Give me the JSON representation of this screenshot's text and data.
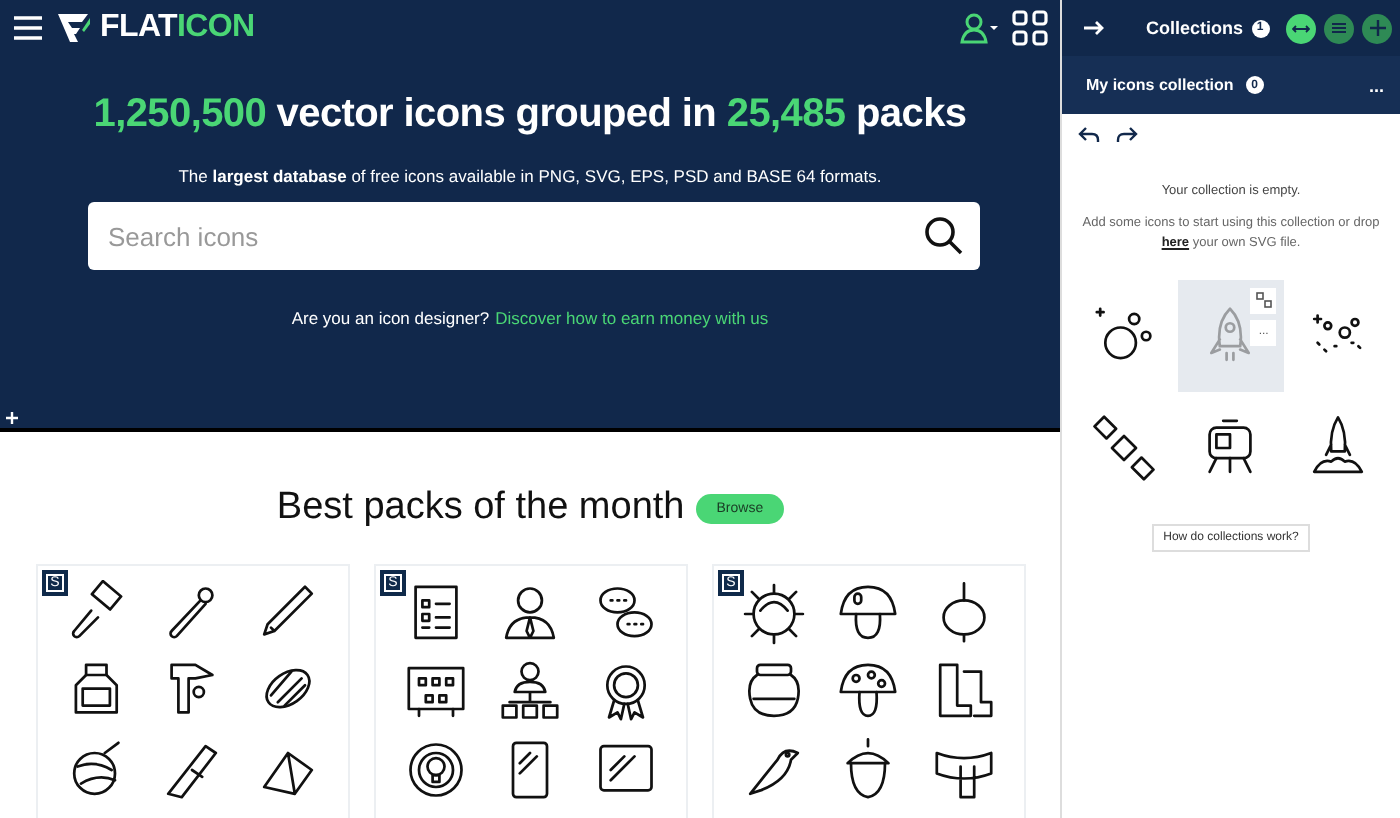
{
  "header": {
    "logo_white": "FLAT",
    "logo_green": "ICON"
  },
  "hero": {
    "title": [
      {
        "text": "1,250,500",
        "highlight": true
      },
      {
        "text": " vector icons grouped in ",
        "highlight": false
      },
      {
        "text": "25,485",
        "highlight": true
      },
      {
        "text": " packs",
        "highlight": false
      }
    ],
    "subtitle": "The **largest database** of free icons available in PNG, SVG, EPS, PSD and BASE 64 formats.",
    "search": {
      "placeholder": "Search icons"
    },
    "designer_text": "Are you an icon designer?",
    "designer_link": "Discover how to earn money with us"
  },
  "best_packs": {
    "title": "Best packs of the month",
    "browse": "Browse",
    "packs": [
      {
        "badge": "S"
      },
      {
        "badge": "S"
      },
      {
        "badge": "S"
      }
    ]
  },
  "sidebar": {
    "collections_label": "Collections",
    "collections_count": "1",
    "view_buttons": [
      {
        "selected": true
      },
      {
        "selected": false
      }
    ],
    "collection_name": "My icons collection",
    "collection_count": "0",
    "menu": "...",
    "empty_title": "Your collection is empty.",
    "empty_before": "Add some icons to start using this collection or drop",
    "empty_link": "here",
    "empty_after": "your own SVG file.",
    "samples": [
      {
        "selected": false
      },
      {
        "selected": true
      },
      {
        "selected": false
      },
      {
        "selected": false
      },
      {
        "selected": false
      },
      {
        "selected": false
      }
    ],
    "sample_menu": "...",
    "help_button": "How do collections work?"
  }
}
